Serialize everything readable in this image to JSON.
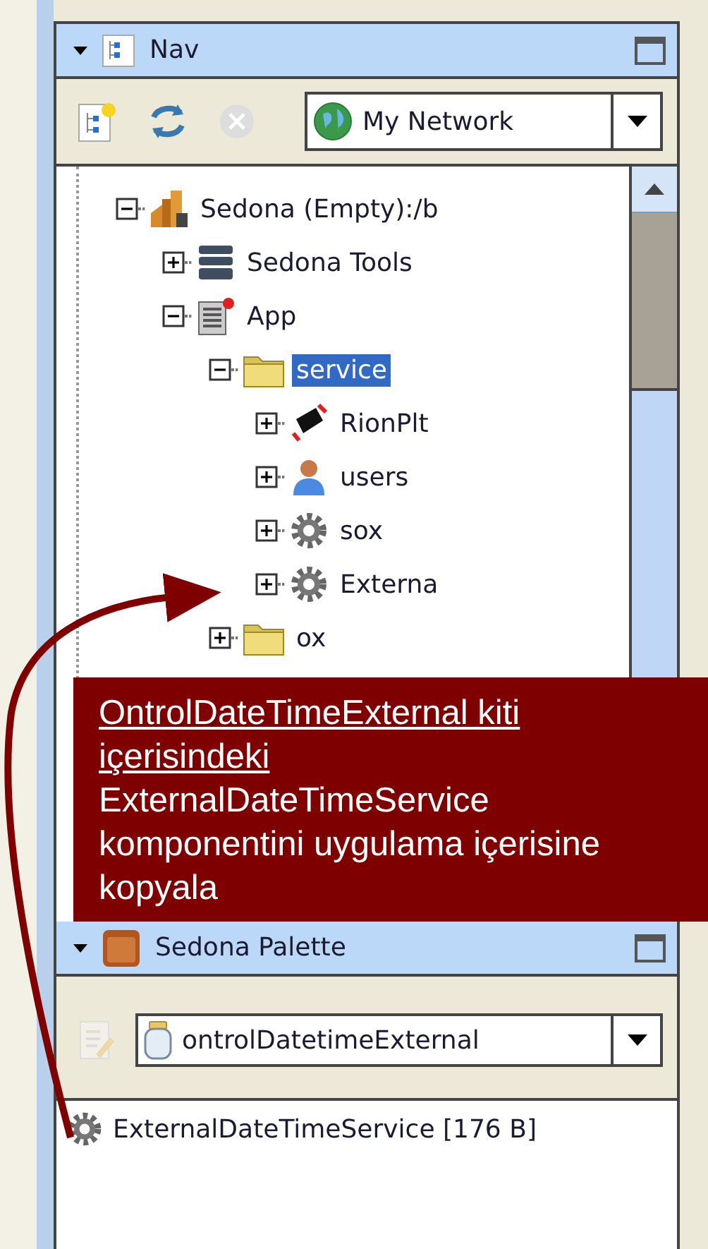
{
  "nav": {
    "title": "Nav",
    "network": "My Network",
    "tree": [
      {
        "label": "Sedona (Empty):/b",
        "kind": "station",
        "expanded": true,
        "selected": false,
        "children": [
          {
            "label": "Sedona Tools",
            "kind": "tools",
            "expanded": false,
            "selected": false
          },
          {
            "label": "App",
            "kind": "app",
            "expanded": true,
            "selected": false,
            "children": [
              {
                "label": "service",
                "kind": "folder",
                "expanded": true,
                "selected": true,
                "children": [
                  {
                    "label": "RionPlt",
                    "kind": "program",
                    "expanded": false,
                    "selected": false
                  },
                  {
                    "label": "users",
                    "kind": "users",
                    "expanded": false,
                    "selected": false
                  },
                  {
                    "label": "sox",
                    "kind": "component",
                    "expanded": false,
                    "selected": false
                  },
                  {
                    "label": "Externa",
                    "kind": "component",
                    "expanded": false,
                    "selected": false
                  }
                ]
              },
              {
                "label": "ox",
                "kind": "folder",
                "expanded": false,
                "selected": false
              }
            ]
          }
        ]
      }
    ]
  },
  "callout": {
    "link": "OntrolDateTimeExternal kiti içerisindeki",
    "text": "ExternalDateTimeService komponentini uygulama içerisine kopyala"
  },
  "palette": {
    "title": "Sedona Palette",
    "kit": "ontrolDatetimeExternal",
    "items": [
      {
        "label": "ExternalDateTimeService [176 B]",
        "kind": "component"
      }
    ]
  }
}
